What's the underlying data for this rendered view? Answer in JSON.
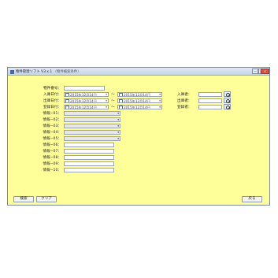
{
  "window": {
    "title": "物件管理ソフト V3.x.1",
    "subtitle": "（物件検索条件）",
    "minimize": "—",
    "maximize": "□",
    "close": "×"
  },
  "form": {
    "property_no_label": "物件番号：",
    "arrival_date_label": "入庫日付：",
    "shipping_date_label": "出庫日付：",
    "register_date_label": "登録日付：",
    "tilde": "〜",
    "arrival_date_from": "2015年12月14日",
    "arrival_date_to": "2015年12月14日",
    "shipping_date_from": "2015年12月14日",
    "shipping_date_to": "2015年12月14日",
    "register_date_from": "2015年12月14日",
    "register_date_to": "2015年12月14日",
    "arrival_person_label": "入庫者：",
    "shipping_person_label": "出庫者：",
    "register_person_label": "登録者：",
    "info_labels": [
      "情報−01：",
      "情報−02：",
      "情報−03：",
      "情報−04：",
      "情報−05：",
      "情報−06：",
      "情報−07：",
      "情報−08：",
      "情報−09：",
      "情報−10："
    ],
    "dropdown_arrow": "▾"
  },
  "buttons": {
    "search": "検索",
    "clear": "クリア",
    "back": "戻る"
  }
}
